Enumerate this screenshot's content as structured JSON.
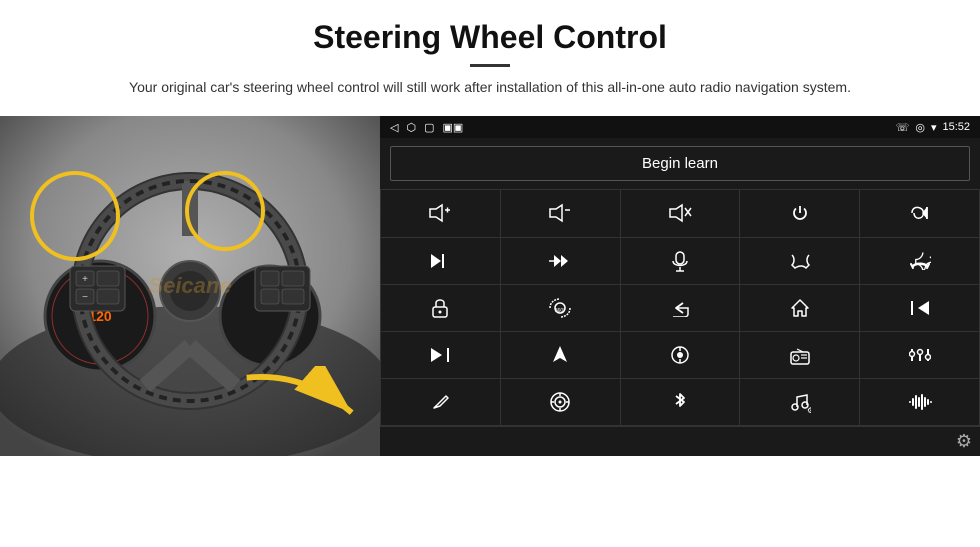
{
  "header": {
    "title": "Steering Wheel Control",
    "subtitle": "Your original car's steering wheel control will still work after installation of this all-in-one auto radio navigation system."
  },
  "android_panel": {
    "statusbar": {
      "back_icon": "◁",
      "home_icon": "⬡",
      "recents_icon": "▢",
      "signal_icon": "▣▣",
      "time": "15:52",
      "phone_icon": "☏",
      "location_icon": "⬡",
      "wifi_icon": "▾"
    },
    "begin_learn_label": "Begin learn",
    "controls": [
      {
        "id": "vol-up",
        "symbol": "vol+"
      },
      {
        "id": "vol-down",
        "symbol": "vol-"
      },
      {
        "id": "mute",
        "symbol": "mute"
      },
      {
        "id": "power",
        "symbol": "pwr"
      },
      {
        "id": "prev-track",
        "symbol": "prev"
      },
      {
        "id": "next-track",
        "symbol": "next"
      },
      {
        "id": "fast-fwd",
        "symbol": "ffwd"
      },
      {
        "id": "mic",
        "symbol": "mic"
      },
      {
        "id": "phone",
        "symbol": "phone"
      },
      {
        "id": "hang-up",
        "symbol": "hangup"
      },
      {
        "id": "car-lock",
        "symbol": "lock"
      },
      {
        "id": "360-cam",
        "symbol": "360"
      },
      {
        "id": "back",
        "symbol": "back"
      },
      {
        "id": "home",
        "symbol": "home"
      },
      {
        "id": "skip-back",
        "symbol": "skipbk"
      },
      {
        "id": "skip-fwd",
        "symbol": "skipfwd"
      },
      {
        "id": "navigate",
        "symbol": "nav"
      },
      {
        "id": "source",
        "symbol": "src"
      },
      {
        "id": "radio",
        "symbol": "radio"
      },
      {
        "id": "equalizer",
        "symbol": "eq"
      },
      {
        "id": "pen",
        "symbol": "pen"
      },
      {
        "id": "target",
        "symbol": "tgt"
      },
      {
        "id": "bluetooth",
        "symbol": "bt"
      },
      {
        "id": "music",
        "symbol": "music"
      },
      {
        "id": "soundwave",
        "symbol": "wave"
      }
    ],
    "settings_label": "⚙"
  },
  "watermark": "Seicane"
}
